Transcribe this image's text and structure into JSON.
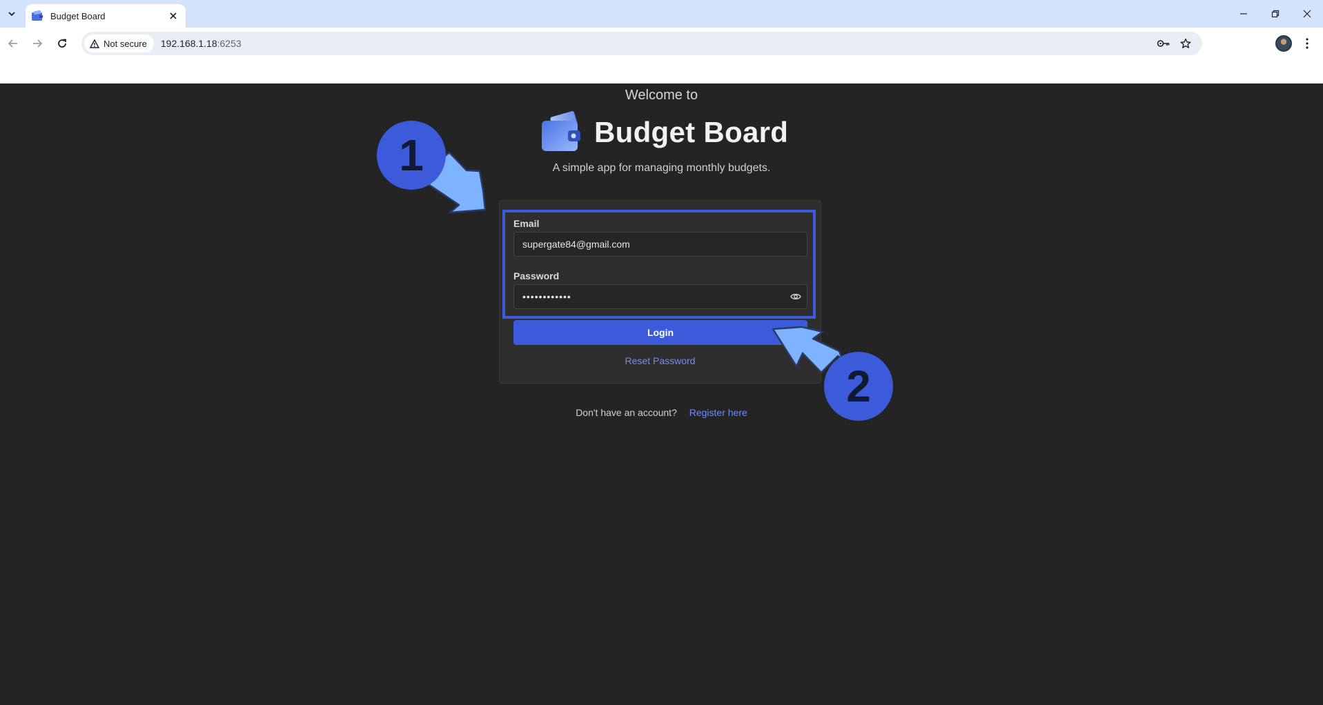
{
  "browser": {
    "tab": {
      "title": "Budget Board"
    },
    "address": {
      "security_label": "Not secure",
      "host": "192.168.1.18",
      "port": ":6253"
    }
  },
  "page": {
    "welcome": "Welcome to",
    "brand_name": "Budget Board",
    "tagline": "A simple app for managing monthly budgets.",
    "form": {
      "email_label": "Email",
      "email_value": "supergate84@gmail.com",
      "password_label": "Password",
      "password_value": "••••••••••••",
      "login_label": "Login",
      "reset_label": "Reset Password"
    },
    "register": {
      "question": "Don't have an account?",
      "link": "Register here"
    }
  },
  "annotations": [
    {
      "number": "1"
    },
    {
      "number": "2"
    }
  ],
  "colors": {
    "accent": "#3b5bdb",
    "arrow": "#7eb4ff",
    "link": "#6e8df5",
    "background": "#242424"
  }
}
